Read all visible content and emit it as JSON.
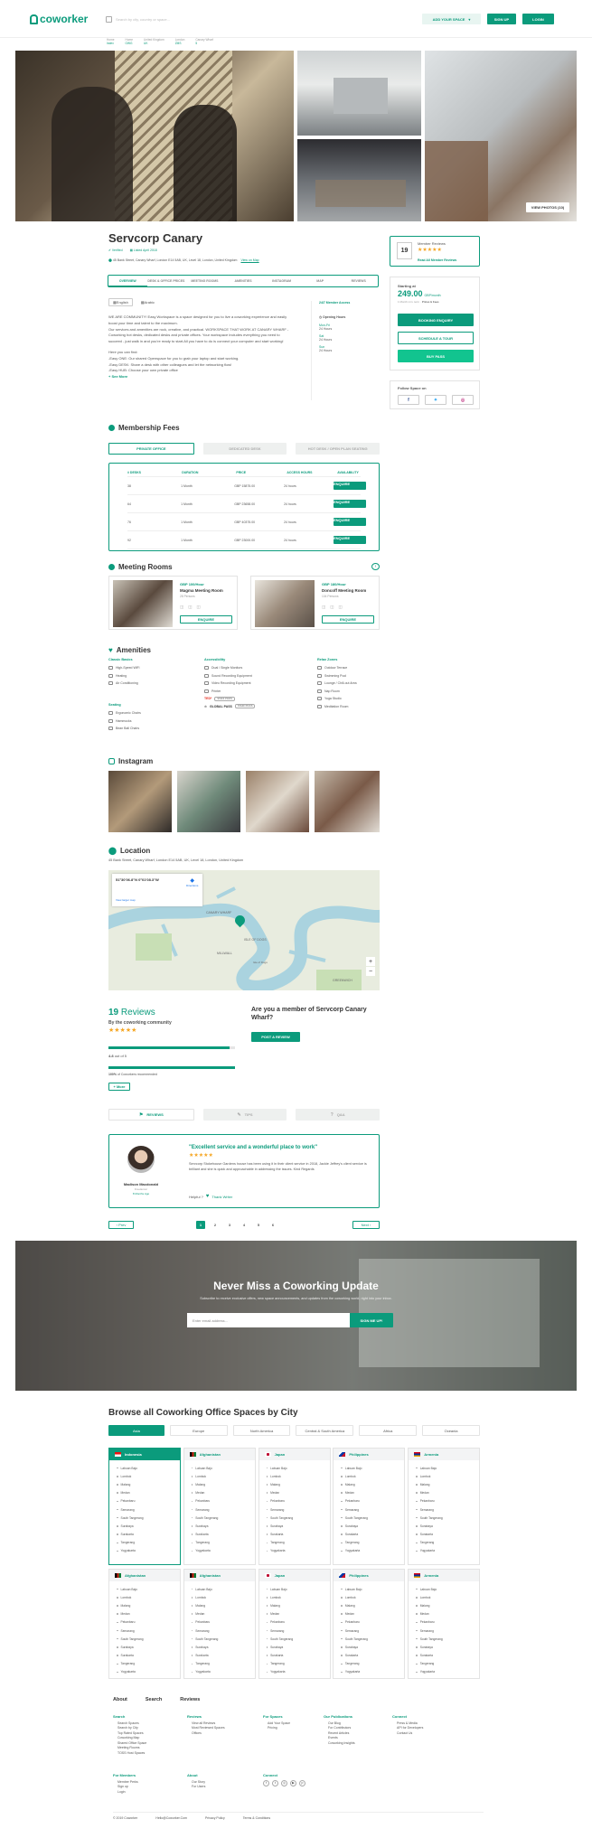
{
  "header": {
    "logo": "coworker",
    "search_placeholder": "Search by city, country or space...",
    "add_space": "ADD YOUR SPACE",
    "signup": "SIGN UP",
    "login": "LOGIN"
  },
  "breadcrumb": {
    "items": [
      {
        "label": "Home",
        "value": "Index"
      },
      {
        "label": "Home",
        "value": "OWG"
      },
      {
        "label": "United Kingdom",
        "value": "UK"
      },
      {
        "label": "London",
        "value": "ZMS"
      },
      {
        "label": "Canary Wharf",
        "value": "5"
      }
    ]
  },
  "gallery": {
    "view_photos": "VIEW PHOTOS (10)"
  },
  "space": {
    "name": "Servcorp Canary",
    "verified": "Verified",
    "listed": "Listed April 2018",
    "address": "45 Bank Street, Canary Wharf, London E14 5AB, UK, Level 18, London, United Kingdom",
    "view_map": "View on Map"
  },
  "tabs": [
    "OVERVIEW",
    "DESK & OFFICE PRICES",
    "MEETING ROOMS",
    "AMENITIES",
    "INSTAGRAM",
    "MAP",
    "REVIEWS"
  ],
  "overview": {
    "lang1": "English",
    "lang2": "Arabic",
    "p1": "WE ARE COMMUNITY! Easy Workspace is a space designed for you to live a coworking experience and easily boost your time and talent to the maximum.",
    "p2": "Our services and amenities are rock, creative, and practical. WORKSPACE THAT WORK AT CANARY WHARF - Coworking hot desks, dedicated desks and private offices. Your workspace includes everything you need to succeed - just walk in and you're ready to start.All you have to do is connect your computer and start working!",
    "p3": "Here you can find:",
    "p4": "-Easy ONE: Our shared Openspace for you to grab your laptop and start working.",
    "p5": "-Easy DESK: Share a desk with other colleagues and let the networking flow!",
    "p6": "-Easy HUB: Choose your own private office",
    "see_more": "+ See More",
    "access": "24/7 Member Access",
    "opening": "Opening Hours",
    "h1": "Mon-Fri",
    "h1v": "24 Hours",
    "h2": "Sat",
    "h2v": "24 Hours",
    "h3": "Sun",
    "h3v": "24 Hours"
  },
  "reviews_box": {
    "score": "19",
    "title": "Member Reviews",
    "link": "Read All Member Reviews"
  },
  "pricing": {
    "starting": "Starting at",
    "price": "249.00",
    "unit": "GBP/month",
    "note": "1 Month min. term",
    "note2": "Prices & Fees",
    "booking": "BOOKING ENQUIRY",
    "tour": "SCHEDULE A TOUR",
    "pass": "BUY PASS"
  },
  "follow": "Follow Space on",
  "fees": {
    "title": "Membership Fees",
    "tabs": [
      "PRIVATE OFFICE",
      "DEDICATED DESK",
      "HOT DESK / OPEN PLAN SEATING"
    ],
    "headers": [
      "# DESKS",
      "DURATION",
      "PRICE",
      "ACCESS HOURS",
      "AVAILABILITY"
    ],
    "rows": [
      [
        "38",
        "1 Month",
        "GBP 15875.00",
        "24 hours",
        "ENQUIRE"
      ],
      [
        "64",
        "1 Month",
        "GBP 23658.00",
        "24 hours",
        "ENQUIRE"
      ],
      [
        "76",
        "1 Month",
        "GBP 40375.00",
        "24 hours",
        "ENQUIRE"
      ],
      [
        "92",
        "1 Month",
        "GBP 23000.00",
        "24 hours",
        "ENQUIRE"
      ]
    ]
  },
  "meeting": {
    "title": "Meeting Rooms",
    "rooms": [
      {
        "price": "GBP 100/Hour",
        "name": "Magma Meeting Room",
        "cap": "28 Persons",
        "btn": "ENQUIRE"
      },
      {
        "price": "GBP 180/Hour",
        "name": "Doncoff Meeting Room",
        "cap": "104 Persons",
        "btn": "ENQUIRE"
      }
    ]
  },
  "amenities": {
    "title": "Amenities",
    "cols": [
      {
        "head": "Classic Basics",
        "items": [
          "High-Speed WiFi",
          "Heating",
          "Air Conditioning"
        ]
      },
      {
        "head": "Accessibility",
        "items": [
          "Dual / Single Monitors",
          "Sound Recording Equipment",
          "Video Recording Equipment",
          "Printer"
        ]
      },
      {
        "head": "Relax Zones",
        "items": [
          "Outdoor Terrace",
          "Swimming Pool",
          "Lounge / Chill-out Area",
          "Nap Room",
          "Yoga Studio",
          "Meditation Room"
        ]
      }
    ],
    "seating_head": "Seating",
    "seating": [
      "Ergonomic Chairs",
      "Hammocks",
      "Bean Ball Chairs"
    ],
    "ted": "TED*",
    "ted_badge": "STAFF PICKS",
    "gp": "GLOBAL PASS",
    "gp_badge": "STAFF PICKS"
  },
  "instagram": {
    "title": "Instagram"
  },
  "location": {
    "title": "Location",
    "address": "45 Bank Street, Canary Wharf, London E14 5AB, UK, Level 18, London, United Kingdom",
    "coords": "51°30'06.8\"N 0°01'08.3\"W",
    "directions": "Directions",
    "larger": "View larger map",
    "labels": [
      "CANARY WHARF",
      "ISLE OF DOGS",
      "MILLWALL",
      "Isle of Dogs",
      "GREENWICH"
    ]
  },
  "reviews": {
    "count": "19",
    "word": "Reviews",
    "by": "By the coworking community",
    "rating": "4.8",
    "out": "out of 5",
    "pct": "100%",
    "pct_text": "of Coworkers recommended",
    "more": "More",
    "member_q": "Are you a member of Servcorp Canary Wharf?",
    "post": "POST A REVIEW",
    "tabs": [
      "REVIEWS",
      "TIPS",
      "Q&A"
    ],
    "quote": "\"Excellent service and a wonderful place to work\"",
    "body": "Servcorp Stokehouse Gardens house has been using it in their client service in 2018, Jackie Jeffrey's client service is brilliant and she is quick and approachable in addressing the issues. Kind Regards",
    "helpful": "Helpful ?",
    "thanks": "Thank Writer",
    "reviewer": "Madison Macdonald",
    "rtype": "Freelancer",
    "rdate": "8 Months Ago",
    "prev": "Prev",
    "next": "Next",
    "pages": [
      "1",
      "2",
      "3",
      "4",
      "5",
      "6"
    ]
  },
  "newsletter": {
    "title": "Never Miss a Coworking Update",
    "sub": "Subscribe to receive exclusive offers, new space announcements, and updates from the coworking world, right into your inbox.",
    "placeholder": "Enter email address...",
    "btn": "SIGN ME UP!"
  },
  "browse": {
    "title": "Browse all Coworking Office Spaces by City",
    "regions": [
      "Asia",
      "Europe",
      "North America",
      "Central & South America",
      "Africa",
      "Oceania"
    ],
    "cards": [
      {
        "country": "Indonesia",
        "flag": "id"
      },
      {
        "country": "Afghanistan",
        "flag": "af"
      },
      {
        "country": "Japan",
        "flag": "jp"
      },
      {
        "country": "Philippines",
        "flag": "ph"
      },
      {
        "country": "Armenia",
        "flag": "am"
      },
      {
        "country": "Afghanistan",
        "flag": "af"
      },
      {
        "country": "Afghanistan",
        "flag": "af"
      },
      {
        "country": "Japan",
        "flag": "jp"
      },
      {
        "country": "Philippines",
        "flag": "ph"
      },
      {
        "country": "Armenia",
        "flag": "am"
      }
    ],
    "cities": [
      "Labuan Bajo",
      "Lombok",
      "Malang",
      "Medan",
      "Pekanbaru",
      "Semarang",
      "South Tangerang",
      "Surabaya",
      "Surakarta",
      "Tangerang",
      "Yogyakarta"
    ]
  },
  "footer": {
    "nav": [
      "About",
      "Search",
      "Reviews"
    ],
    "cols": [
      {
        "head": "Search",
        "items": [
          "Search Spaces",
          "Search by City",
          "Top Rated Spaces",
          "Coworking Map",
          "Shared Office Space",
          "Meeting Rooms",
          "TOSS Host Spaces"
        ]
      },
      {
        "head": "Reviews",
        "items": [
          "View all Reviews",
          "Most Reviewed Spaces",
          "Offices"
        ]
      },
      {
        "head": "For Spaces",
        "items": [
          "Add Your Space",
          "Pricing"
        ]
      },
      {
        "head": "Our Publications",
        "items": [
          "Our Blog",
          "For Contributors",
          "Recent Articles",
          "Events",
          "Coworking Insights"
        ]
      },
      {
        "head": "Connect",
        "items": [
          "Press & Media",
          "API for Developers",
          "Contact Us"
        ]
      }
    ],
    "members_head": "For Members",
    "members": [
      "Member Perks",
      "Sign up",
      "Login"
    ],
    "about_head": "About",
    "about": [
      "Our Story",
      "For Users"
    ],
    "connect_head": "Connect",
    "copy": "© 2019 Coworker",
    "email": "Hello@Coworker.Com",
    "privacy": "Privacy Policy",
    "terms": "Terms & Conditions"
  },
  "colors": {
    "accent": "#0b9b7c",
    "star": "#f5a623"
  }
}
